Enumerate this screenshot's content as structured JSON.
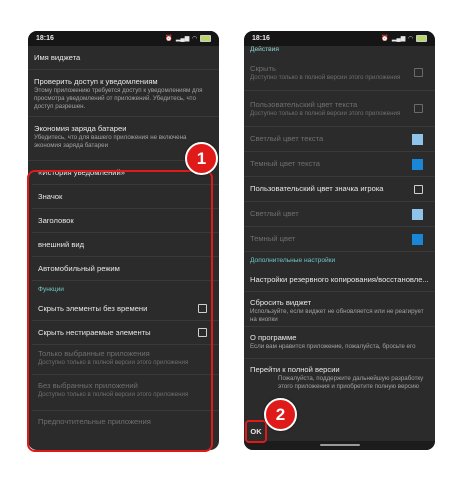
{
  "left": {
    "time": "18:16",
    "rows": {
      "widget_name": "Имя виджета",
      "notif_title": "Проверить доступ к уведомлениям",
      "notif_sub": "Этому приложению требуется доступ к уведомлениям для просмотра уведомлений от приложений. Убедитесь, что доступ разрешен.",
      "battery_title": "Экономия заряда батареи",
      "battery_sub": "Убедитесь, что для вашего приложения не включена экономия заряда батареи",
      "history": "«История уведомлений»",
      "icon": "Значок",
      "heading": "Заголовок",
      "appearance": "внешний вид",
      "car_mode": "Автомобильный режим",
      "functions_section": "Функции",
      "hide_untimed": "Скрыть элементы без времени",
      "hide_permanent": "Скрыть нестираемые элементы",
      "only_selected_title": "Только выбранные приложения",
      "only_selected_sub": "Доступно только в полной версии этого приложения",
      "without_selected_title": "Без выбранных приложений",
      "without_selected_sub": "Доступно только в полной версии этого приложения",
      "preferred_title": "Предпочтительные приложения"
    }
  },
  "right": {
    "time": "18:16",
    "rows": {
      "actions_section": "Действия",
      "hide_title": "Скрыть",
      "hide_sub": "Доступно только в полной версии этого приложения",
      "custom_text_title": "Пользовательский цвет текста",
      "custom_text_sub": "Доступно только в полной версии этого приложения",
      "light_text": "Светлый цвет текста",
      "dark_text": "Темный цвет текста",
      "player_icon_color": "Пользовательский цвет значка игрока",
      "light_color": "Светлый цвет",
      "dark_color": "Темный цвет",
      "extra_section": "Дополнительные настройки",
      "backup": "Настройки резервного копирования/восстановле...",
      "reset_title": "Сбросить виджет",
      "reset_sub": "Используйте, если виджет не обновляется или не реагирует на кнопки",
      "about_title": "О программе",
      "about_sub": "Если вам нравится приложение, пожалуйста, бросьте его",
      "full_title": "Перейти к полной версии",
      "full_sub": "Пожалуйста, поддержите дальнейшую разработку этого приложения и приобретите полную версию",
      "ok": "OK"
    }
  },
  "badges": {
    "one": "1",
    "two": "2"
  },
  "colors": {
    "highlight": "#e01919",
    "swatch_light_text": "#8fc3ea",
    "swatch_dark_text": "#1a86d8",
    "swatch_light": "#8fc3ea",
    "swatch_dark": "#1a86d8",
    "section_accent": "#6dc7c2"
  }
}
